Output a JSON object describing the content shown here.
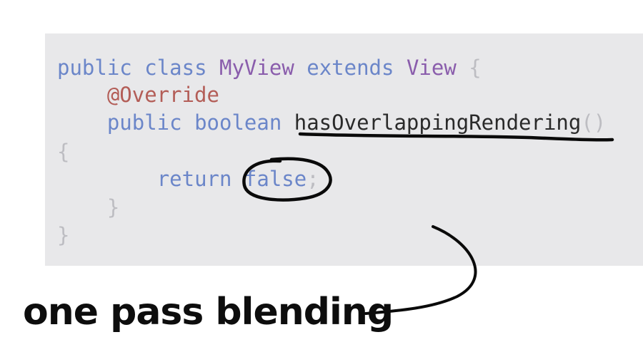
{
  "code": {
    "line1": {
      "kw1": "public",
      "kw2": "class",
      "name": "MyView",
      "kw3": "extends",
      "parent": "View",
      "brace": "{"
    },
    "line2": {
      "annotation": "@Override"
    },
    "line3": {
      "kw1": "public",
      "kw2": "boolean",
      "method": "hasOverlappingRendering",
      "parens": "()"
    },
    "line4": {
      "brace": "{"
    },
    "line5": {
      "kw": "return",
      "value": "false",
      "semi": ";"
    },
    "line6": {
      "brace": "}"
    },
    "line7": {
      "brace": "}"
    }
  },
  "caption": "one pass blending",
  "colors": {
    "panel": "#e8e8ea",
    "keyword": "#6b86c9",
    "class_name": "#8a5dac",
    "annotation": "#b35d57",
    "punctuation": "#bdbdc2",
    "ink": "#0d0d0d"
  }
}
